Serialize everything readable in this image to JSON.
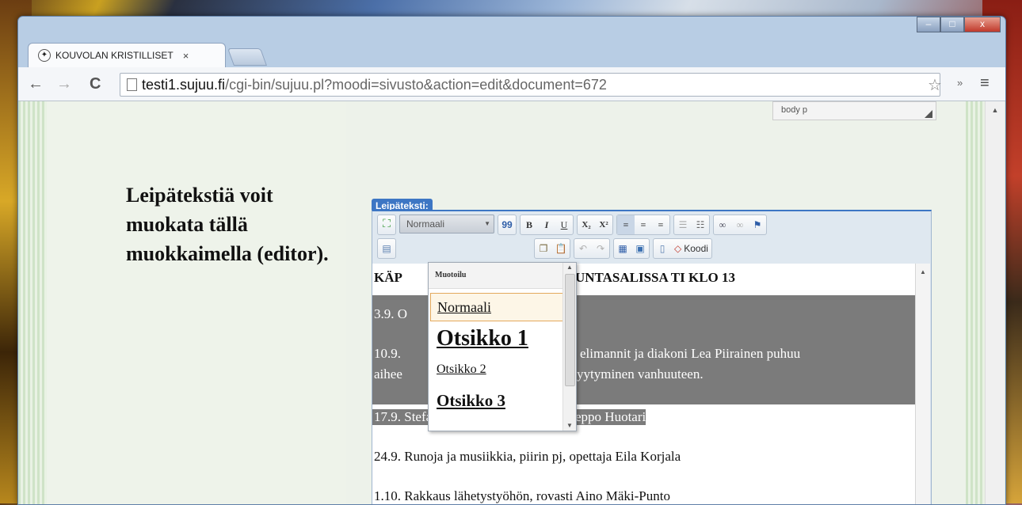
{
  "window": {
    "tab_title": "KOUVOLAN KRISTILLISET",
    "tab_close": "×",
    "minimize": "–",
    "maximize": "□",
    "close": "x"
  },
  "toolbar": {
    "back": "←",
    "forward": "→",
    "reload": "C",
    "url_host": "testi1.sujuu.fi",
    "url_path": "/cgi-bin/sujuu.pl?moodi=sivusto&action=edit&document=672",
    "star": "☆",
    "extensions": "»",
    "menu": "≡"
  },
  "left_panel": {
    "text": "Leipätekstiä voit muokata tällä muokkaimella (editor)."
  },
  "path_bar": "body  p",
  "editor": {
    "label": "Leipäteksti:",
    "format_combo": "Normaali",
    "quote_btn": "99",
    "bold": "B",
    "italic": "I",
    "underline": "U",
    "subscript": "X₂",
    "superscript": "X²",
    "source_label": "Koodi",
    "dropdown": {
      "header": "Muotoilu",
      "items": [
        "Normaali",
        "Otsikko 1",
        "Otsikko 2",
        "Otsikko 3"
      ]
    },
    "content": {
      "heading": "KÄPYLÄN SEURAKUNTASALISSA TI KLO 13",
      "heading_visible": "UNTASALISSA TI KLO 13",
      "line1": "3.9. O",
      "line2a": "10.9.",
      "line2b": "elimannit ja diakoni Lea Piirainen puhuu",
      "line3a": "aihee",
      "line3b": "yytyminen vanhuuteen.",
      "line4": "17.9. Stefanus-lähetyksestä, pastori Seppo Huotari",
      "line5": "24.9. Runoja ja musiikkia, piirin pj, opettaja Eila Korjala",
      "line6": "1.10. Rakkaus lähetystyöhön, rovasti Aino Mäki-Punto"
    }
  }
}
